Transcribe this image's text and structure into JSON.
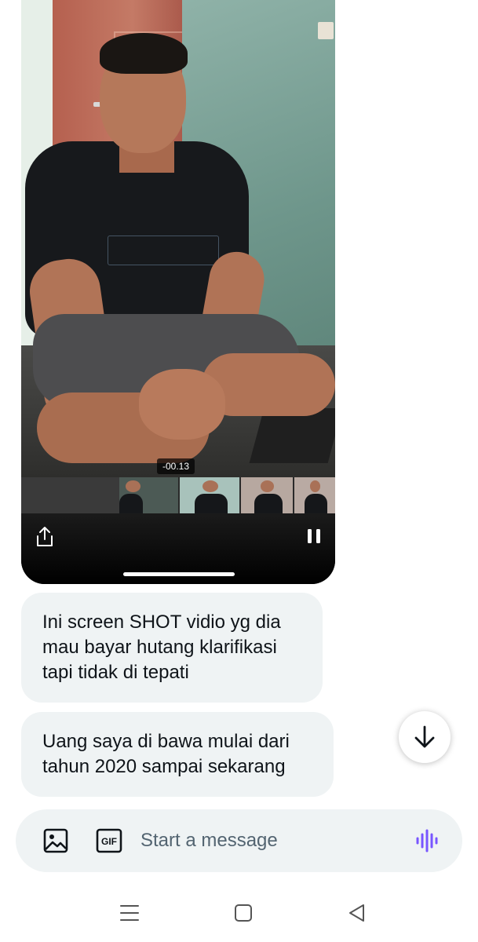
{
  "video": {
    "time_remaining": "-00.13",
    "share_icon": "share-icon",
    "pause_icon": "pause-icon"
  },
  "messages": [
    {
      "text": "Ini screen SHOT vidio yg dia mau bayar hutang klarifikasi tapi tidak di tepati"
    },
    {
      "text": "Uang saya di bawa mulai dari tahun 2020 sampai sekarang"
    }
  ],
  "scroll_button": {
    "icon": "arrow-down-icon"
  },
  "composer": {
    "placeholder": "Start a message",
    "gif_label": "GIF",
    "media_icon": "image-icon",
    "voice_icon": "voice-waveform-icon",
    "voice_color": "#7856ff"
  },
  "navbar": {
    "icons": [
      "menu-icon",
      "home-square-icon",
      "back-triangle-icon"
    ]
  }
}
